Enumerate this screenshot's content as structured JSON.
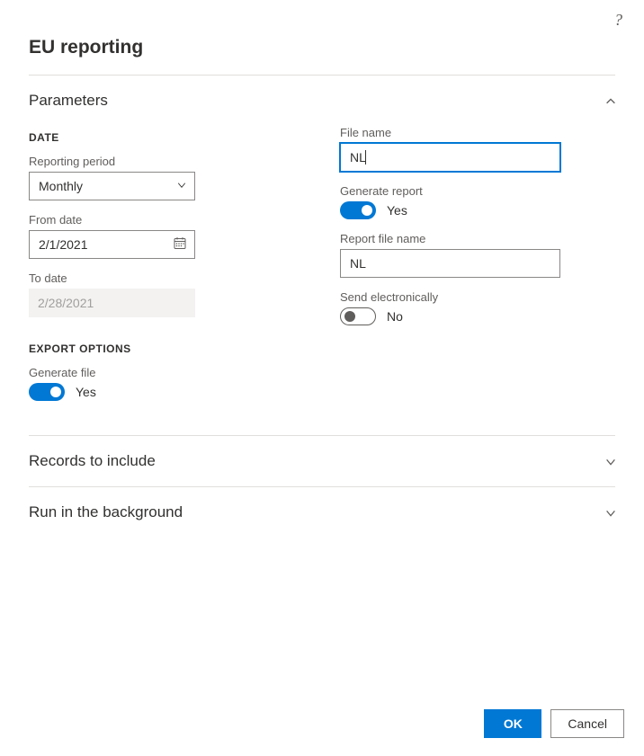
{
  "header": {
    "title": "EU reporting"
  },
  "sections": {
    "parameters": {
      "title": "Parameters",
      "date_group": "DATE",
      "export_group": "EXPORT OPTIONS",
      "reporting_period": {
        "label": "Reporting period",
        "value": "Monthly"
      },
      "from_date": {
        "label": "From date",
        "value": "2/1/2021"
      },
      "to_date": {
        "label": "To date",
        "value": "2/28/2021"
      },
      "generate_file": {
        "label": "Generate file",
        "value": "Yes",
        "on": true
      },
      "file_name": {
        "label": "File name",
        "value": "NL"
      },
      "generate_report": {
        "label": "Generate report",
        "value": "Yes",
        "on": true
      },
      "report_file_name": {
        "label": "Report file name",
        "value": "NL"
      },
      "send_electronically": {
        "label": "Send electronically",
        "value": "No",
        "on": false
      }
    },
    "records": {
      "title": "Records to include"
    },
    "background": {
      "title": "Run in the background"
    }
  },
  "footer": {
    "ok": "OK",
    "cancel": "Cancel"
  }
}
